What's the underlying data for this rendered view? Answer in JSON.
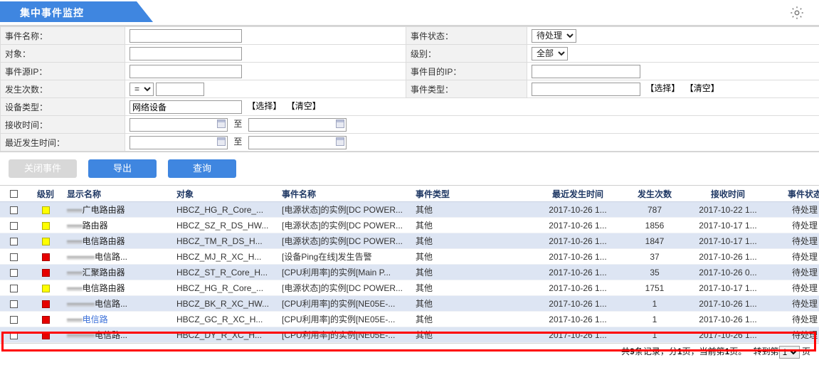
{
  "window": {
    "title": "集中事件监控",
    "settings_icon": "gear-icon"
  },
  "form": {
    "rows": [
      {
        "label": "事件名称：",
        "label2": "事件状态：",
        "value2": "待处理"
      },
      {
        "label": "对象：",
        "label2": "级别：",
        "value2": "全部"
      },
      {
        "label": "事件源IP：",
        "label2": "事件目的IP："
      },
      {
        "label": "发生次数：",
        "operator": "=",
        "label2": "事件类型："
      }
    ],
    "event_name_label": "事件名称：",
    "event_name_value": "",
    "object_label": "对象：",
    "object_value": "",
    "source_ip_label": "事件源IP：",
    "source_ip_value": "",
    "occur_count_label": "发生次数：",
    "occur_count_operator": "=",
    "occur_count_value": "",
    "event_status_label": "事件状态：",
    "event_status_value": "待处理",
    "level_label": "级别：",
    "level_value": "全部",
    "dest_ip_label": "事件目的IP：",
    "dest_ip_value": "",
    "event_type_label": "事件类型：",
    "event_type_value": "",
    "event_type_select": "【选择】",
    "event_type_clear": "【清空】",
    "device_type_label": "设备类型：",
    "device_type_value": "网络设备",
    "device_type_select": "【选择】",
    "device_type_clear": "【清空】",
    "recv_time_label": "接收时间：",
    "recv_time_from": "",
    "recv_time_to": "",
    "recv_time_sep": "至",
    "last_time_label": "最近发生时间：",
    "last_time_from": "",
    "last_time_to": "",
    "last_time_sep": "至"
  },
  "toolbar": {
    "close_event_label": "关闭事件",
    "export_label": "导出",
    "query_label": "查询"
  },
  "grid": {
    "headers": {
      "check": "",
      "level": "级别",
      "display_name": "显示名称",
      "object": "对象",
      "event_name": "事件名称",
      "event_type": "事件类型",
      "last_occur_time": "最近发生时间",
      "occur_count": "发生次数",
      "recv_time": "接收时间",
      "event_status": "事件状态"
    },
    "rows": [
      {
        "level": "yellow",
        "name_masked": "",
        "name": "广电路由器",
        "object": "HBCZ_HG_R_Core_...",
        "event": "[电源状态]的实例[DC POWER...",
        "type": "其他",
        "last": "2017-10-26 1...",
        "count": "787",
        "recv": "2017-10-22 1...",
        "status": "待处理",
        "highlight": false,
        "link": false
      },
      {
        "level": "yellow",
        "name_masked": "",
        "name": "路由器",
        "object": "HBCZ_SZ_R_DS_HW...",
        "event": "[电源状态]的实例[DC POWER...",
        "type": "其他",
        "last": "2017-10-26 1...",
        "count": "1856",
        "recv": "2017-10-17 1...",
        "status": "待处理",
        "highlight": false,
        "link": false
      },
      {
        "level": "yellow",
        "name_masked": "",
        "name": "电信路由器",
        "object": "HBCZ_TM_R_DS_H...",
        "event": "[电源状态]的实例[DC POWER...",
        "type": "其他",
        "last": "2017-10-26 1...",
        "count": "1847",
        "recv": "2017-10-17 1...",
        "status": "待处理",
        "highlight": false,
        "link": false
      },
      {
        "level": "red",
        "name_masked": "",
        "name": "电信路...",
        "object": "HBCZ_MJ_R_XC_H...",
        "event": "[设备Ping在线]发生告警",
        "type": "其他",
        "last": "2017-10-26 1...",
        "count": "37",
        "recv": "2017-10-26 1...",
        "status": "待处理",
        "highlight": false,
        "link": false
      },
      {
        "level": "red",
        "name_masked": "",
        "name": "汇聚路由器",
        "object": "HBCZ_ST_R_Core_H...",
        "event": "[CPU利用率]的实例[Main P...",
        "type": "其他",
        "last": "2017-10-26 1...",
        "count": "35",
        "recv": "2017-10-26 0...",
        "status": "待处理",
        "highlight": false,
        "link": false
      },
      {
        "level": "yellow",
        "name_masked": "",
        "name": "电信路由器",
        "object": "HBCZ_HG_R_Core_...",
        "event": "[电源状态]的实例[DC POWER...",
        "type": "其他",
        "last": "2017-10-26 1...",
        "count": "1751",
        "recv": "2017-10-17 1...",
        "status": "待处理",
        "highlight": false,
        "link": false
      },
      {
        "level": "red",
        "name_masked": "",
        "name": "电信路...",
        "object": "HBCZ_BK_R_XC_HW...",
        "event": "[CPU利用率]的实例[NE05E-...",
        "type": "其他",
        "last": "2017-10-26 1...",
        "count": "1",
        "recv": "2017-10-26 1...",
        "status": "待处理",
        "highlight": false,
        "link": false
      },
      {
        "level": "red",
        "name_masked": "",
        "name": "电信路",
        "object": "HBCZ_GC_R_XC_H...",
        "event": "[CPU利用率]的实例[NE05E-...",
        "type": "其他",
        "last": "2017-10-26 1...",
        "count": "1",
        "recv": "2017-10-26 1...",
        "status": "待处理",
        "highlight": false,
        "link": true
      },
      {
        "level": "red",
        "name_masked": "",
        "name": "电信路...",
        "object": "HBCZ_DY_R_XC_H...",
        "event": "[CPU利用率]的实例[NE05E-...",
        "type": "其他",
        "last": "2017-10-26 1...",
        "count": "1",
        "recv": "2017-10-26 1...",
        "status": "待处理",
        "highlight": true,
        "link": false
      }
    ]
  },
  "footer": {
    "text_1": "共",
    "total": "9",
    "text_2": "条记录，分",
    "pages": "1",
    "text_3": "页，当前第",
    "current": "1",
    "text_4": "页。",
    "goto_label": "转到第",
    "goto_value": "1",
    "page_unit": "页"
  },
  "colors": {
    "accent": "#3f86e0",
    "header_text": "#1f3864",
    "row_alt": "#dde5f3",
    "level_yellow": "#ffff00",
    "level_red": "#e60000",
    "annotation": "#ff0000"
  }
}
